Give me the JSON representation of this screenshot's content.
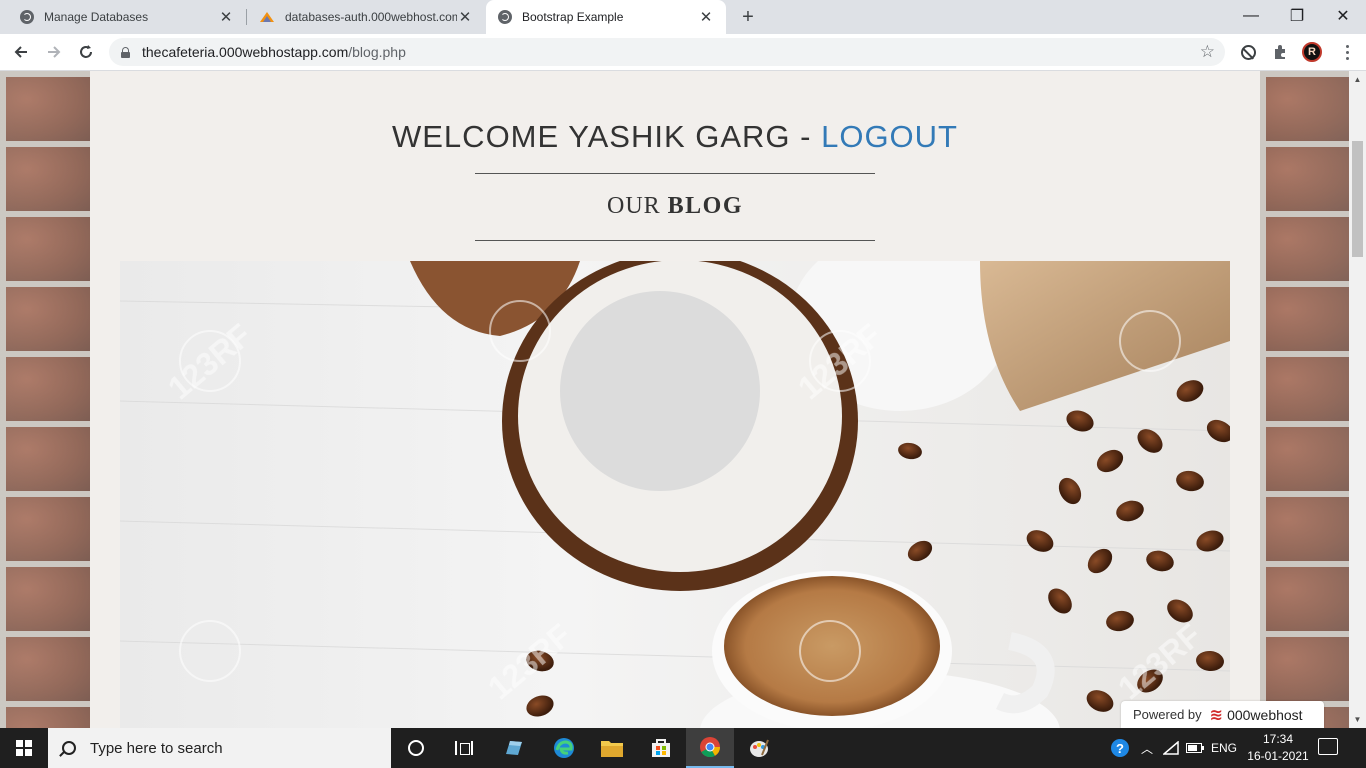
{
  "browser": {
    "tabs": [
      {
        "title": "Manage Databases",
        "icon": "globe-icon",
        "active": false
      },
      {
        "title": "databases-auth.000webhost.com",
        "icon": "phpmyadmin-icon",
        "active": false
      },
      {
        "title": "Bootstrap Example",
        "icon": "globe-icon",
        "active": true
      }
    ],
    "new_tab": "+",
    "window_controls": {
      "minimize": "—",
      "restore": "❐",
      "close": "✕"
    },
    "url_domain": "thecafeteria.000webhostapp.com",
    "url_path": "/blog.php",
    "profile_initial": "R"
  },
  "page": {
    "welcome_text": "WELCOME YASHIK GARG - ",
    "logout_label": "LOGOUT",
    "blog_heading_plain": "OUR ",
    "blog_heading_bold": "BLOG",
    "hero_watermark": "123RF",
    "powered_by": "Powered by",
    "host_brand": "000webhost"
  },
  "taskbar": {
    "search_placeholder": "Type here to search",
    "language": "ENG",
    "time": "17:34",
    "date": "16-01-2021"
  },
  "colors": {
    "link": "#337ab7",
    "panel": "#f2efec",
    "taskbar": "#1f1f1f"
  }
}
